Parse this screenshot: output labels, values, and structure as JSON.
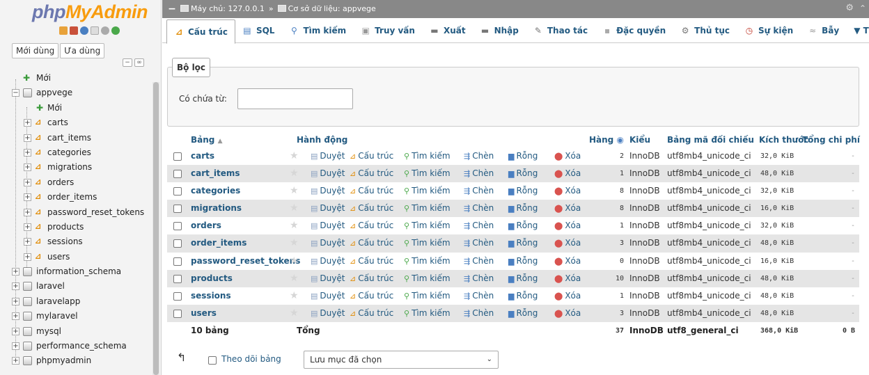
{
  "nav": {
    "logo_php": "php",
    "logo_myadmin": "MyAdmin",
    "recent_label": "Mới dùng",
    "favorite_label": "Ưa dùng",
    "tree": [
      {
        "label": "Mới",
        "type": "new",
        "level": 0
      },
      {
        "label": "appvege",
        "type": "db",
        "level": 0,
        "expanded": true
      },
      {
        "label": "Mới",
        "type": "new",
        "level": 1
      },
      {
        "label": "carts",
        "type": "table",
        "level": 1
      },
      {
        "label": "cart_items",
        "type": "table",
        "level": 1
      },
      {
        "label": "categories",
        "type": "table",
        "level": 1
      },
      {
        "label": "migrations",
        "type": "table",
        "level": 1
      },
      {
        "label": "orders",
        "type": "table",
        "level": 1
      },
      {
        "label": "order_items",
        "type": "table",
        "level": 1
      },
      {
        "label": "password_reset_tokens",
        "type": "table",
        "level": 1
      },
      {
        "label": "products",
        "type": "table",
        "level": 1
      },
      {
        "label": "sessions",
        "type": "table",
        "level": 1
      },
      {
        "label": "users",
        "type": "table",
        "level": 1
      },
      {
        "label": "information_schema",
        "type": "db",
        "level": 0
      },
      {
        "label": "laravel",
        "type": "db",
        "level": 0
      },
      {
        "label": "laravelapp",
        "type": "db",
        "level": 0
      },
      {
        "label": "mylaravel",
        "type": "db",
        "level": 0
      },
      {
        "label": "mysql",
        "type": "db",
        "level": 0
      },
      {
        "label": "performance_schema",
        "type": "db",
        "level": 0
      },
      {
        "label": "phpmyadmin",
        "type": "db",
        "level": 0
      }
    ]
  },
  "topbar": {
    "server": "Máy chủ: 127.0.0.1",
    "sep": "»",
    "database": "Cơ sở dữ liệu: appvege"
  },
  "tabs": [
    {
      "label": "Cấu trúc",
      "icon": "structure-icon",
      "glyph": "▦",
      "active": true
    },
    {
      "label": "SQL",
      "icon": "sql-icon",
      "glyph": "▤"
    },
    {
      "label": "Tìm kiếm",
      "icon": "search-icon",
      "glyph": "🔍"
    },
    {
      "label": "Truy vấn",
      "icon": "query-icon",
      "glyph": "▣"
    },
    {
      "label": "Xuất",
      "icon": "export-icon",
      "glyph": "▬"
    },
    {
      "label": "Nhập",
      "icon": "import-icon",
      "glyph": "▬"
    },
    {
      "label": "Thao tác",
      "icon": "wrench-icon",
      "glyph": "✎"
    },
    {
      "label": "Đặc quyền",
      "icon": "privileges-icon",
      "glyph": "▪"
    },
    {
      "label": "Thủ tục",
      "icon": "routines-icon",
      "glyph": "⚙"
    },
    {
      "label": "Sự kiện",
      "icon": "events-icon",
      "glyph": "◷"
    },
    {
      "label": "Bẫy",
      "icon": "triggers-icon",
      "glyph": "⚡"
    },
    {
      "label": "▼ T",
      "icon": "more-icon",
      "glyph": ""
    }
  ],
  "filter": {
    "legend": "Bộ lọc",
    "label": "Có chứa từ:",
    "value": ""
  },
  "table": {
    "headers": {
      "name": "Bảng",
      "action": "Hành động",
      "rows": "Hàng",
      "type": "Kiểu",
      "collation": "Bảng mã đối chiếu",
      "size": "Kích thước",
      "overhead": "Tổng chi phí"
    },
    "actions": {
      "browse": "Duyệt",
      "structure": "Cấu trúc",
      "search": "Tìm kiếm",
      "insert": "Chèn",
      "empty": "Rỗng",
      "drop": "Xóa"
    },
    "rows": [
      {
        "name": "carts",
        "rows": "2",
        "type": "InnoDB",
        "collation": "utf8mb4_unicode_ci",
        "size": "32,0 KiB",
        "overhead": "-"
      },
      {
        "name": "cart_items",
        "rows": "1",
        "type": "InnoDB",
        "collation": "utf8mb4_unicode_ci",
        "size": "48,0 KiB",
        "overhead": "-"
      },
      {
        "name": "categories",
        "rows": "8",
        "type": "InnoDB",
        "collation": "utf8mb4_unicode_ci",
        "size": "32,0 KiB",
        "overhead": "-"
      },
      {
        "name": "migrations",
        "rows": "8",
        "type": "InnoDB",
        "collation": "utf8mb4_unicode_ci",
        "size": "16,0 KiB",
        "overhead": "-"
      },
      {
        "name": "orders",
        "rows": "1",
        "type": "InnoDB",
        "collation": "utf8mb4_unicode_ci",
        "size": "32,0 KiB",
        "overhead": "-"
      },
      {
        "name": "order_items",
        "rows": "3",
        "type": "InnoDB",
        "collation": "utf8mb4_unicode_ci",
        "size": "48,0 KiB",
        "overhead": "-"
      },
      {
        "name": "password_reset_tokens",
        "rows": "0",
        "type": "InnoDB",
        "collation": "utf8mb4_unicode_ci",
        "size": "16,0 KiB",
        "overhead": "-"
      },
      {
        "name": "products",
        "rows": "10",
        "type": "InnoDB",
        "collation": "utf8mb4_unicode_ci",
        "size": "48,0 KiB",
        "overhead": "-"
      },
      {
        "name": "sessions",
        "rows": "1",
        "type": "InnoDB",
        "collation": "utf8mb4_unicode_ci",
        "size": "48,0 KiB",
        "overhead": "-"
      },
      {
        "name": "users",
        "rows": "3",
        "type": "InnoDB",
        "collation": "utf8mb4_unicode_ci",
        "size": "48,0 KiB",
        "overhead": "-"
      }
    ],
    "footer": {
      "count": "10 bảng",
      "total_label": "Tổng",
      "rows": "37",
      "type": "InnoDB",
      "collation": "utf8_general_ci",
      "size": "368,0 KiB",
      "overhead": "0 B"
    }
  },
  "bottom": {
    "check_label": "Theo dõi bảng",
    "select_value": "Lưu mục đã chọn"
  }
}
